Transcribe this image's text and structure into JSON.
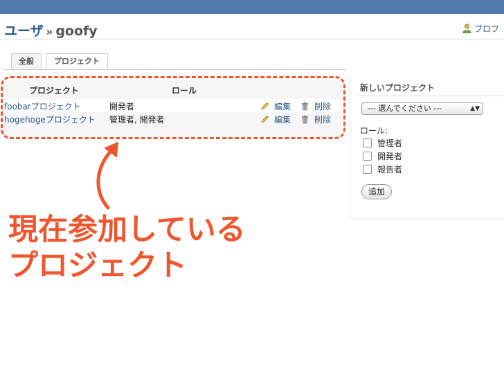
{
  "header": {
    "breadcrumb_parent": "ユーザ",
    "breadcrumb_separator": "»",
    "breadcrumb_current": "goofy",
    "profile_link": "プロフ"
  },
  "tabs": [
    {
      "label": "全般",
      "active": false
    },
    {
      "label": "プロジェクト",
      "active": true
    }
  ],
  "table": {
    "columns": [
      "プロジェクト",
      "ロール"
    ],
    "rows": [
      {
        "project": "foobarプロジェクト",
        "roles": "開発者",
        "edit": "編集",
        "delete": "削除"
      },
      {
        "project": "hogehogeプロジェクト",
        "roles": "管理者, 開発者",
        "edit": "編集",
        "delete": "削除"
      }
    ]
  },
  "sidebar": {
    "title": "新しいプロジェクト",
    "select_value": "--- 選んでください ---",
    "roles_label": "ロール:",
    "roles": [
      "管理者",
      "開発者",
      "報告者"
    ],
    "add_button": "追加"
  },
  "annotation": {
    "line1": "現在参加している",
    "line2": "プロジェクト"
  },
  "colors": {
    "accent": "#f0562e",
    "link": "#2a5685",
    "topbar": "#507aaa"
  }
}
